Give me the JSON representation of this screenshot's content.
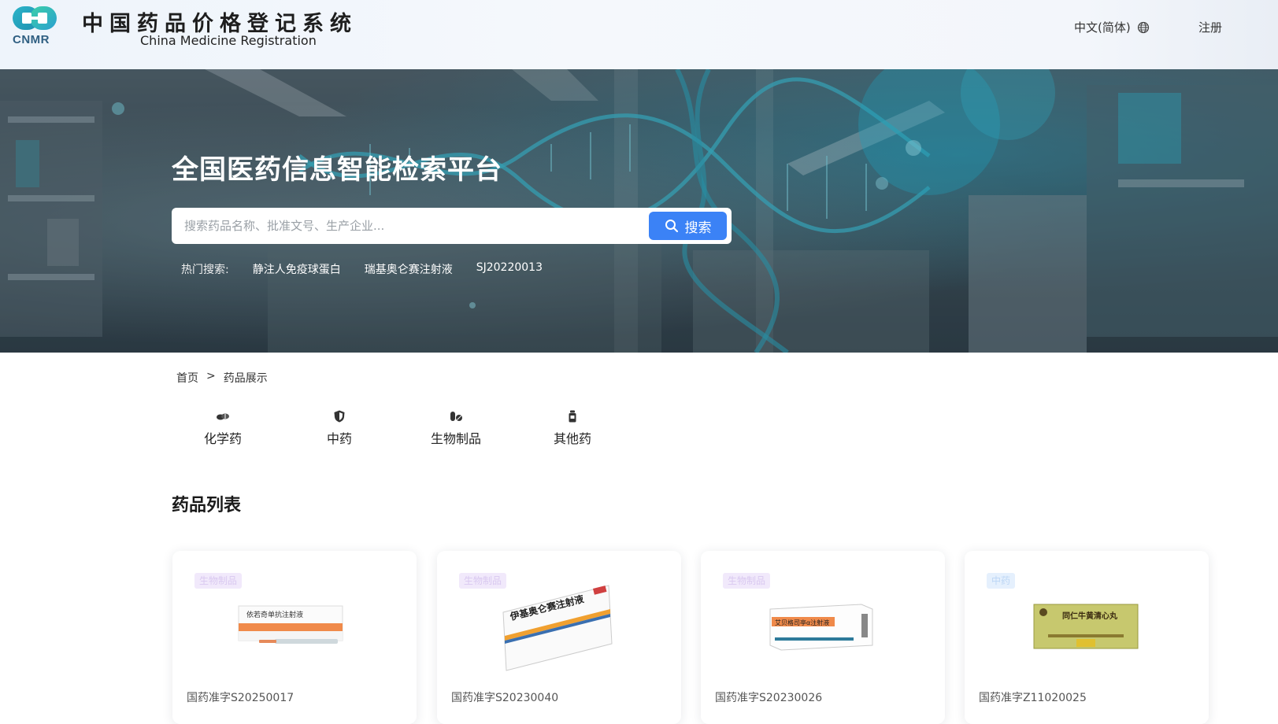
{
  "header": {
    "logo_text": "CNMR",
    "site_title": "中国药品价格登记系统",
    "site_subtitle": "China Medicine Registration",
    "language": "中文(简体)",
    "register": "注册"
  },
  "banner": {
    "title": "全国医药信息智能检索平台",
    "search_placeholder": "搜索药品名称、批准文号、生产企业...",
    "search_button": "搜索",
    "hot_label": "热门搜索:",
    "hot_keywords": [
      "静注人免疫球蛋白",
      "瑞基奥仑赛注射液",
      "SJ20220013"
    ]
  },
  "breadcrumb": {
    "home": "首页",
    "separator": ">",
    "current": "药品展示"
  },
  "categories": [
    {
      "label": "化学药",
      "icon": "pills-icon"
    },
    {
      "label": "中药",
      "icon": "shield-icon"
    },
    {
      "label": "生物制品",
      "icon": "capsules-icon"
    },
    {
      "label": "其他药",
      "icon": "bottle-icon"
    }
  ],
  "section_title": "药品列表",
  "products": [
    {
      "tag": "生物制品",
      "tag_type": "bio",
      "approval": "国药准字S20250017",
      "box_text": "依若奇单抗注射液"
    },
    {
      "tag": "生物制品",
      "tag_type": "bio",
      "approval": "国药准字S20230040",
      "box_text": "伊基奥仑赛注射液"
    },
    {
      "tag": "生物制品",
      "tag_type": "bio",
      "approval": "国药准字S20230026",
      "box_text": "艾贝格司亭α注射液"
    },
    {
      "tag": "中药",
      "tag_type": "tcm",
      "approval": "国药准字Z11020025",
      "box_text": "同仁牛黄清心丸"
    }
  ],
  "colors": {
    "accent": "#3b82f6",
    "bio_tag_bg": "#f1e9fb",
    "tcm_tag_bg": "#e5f0fd"
  }
}
